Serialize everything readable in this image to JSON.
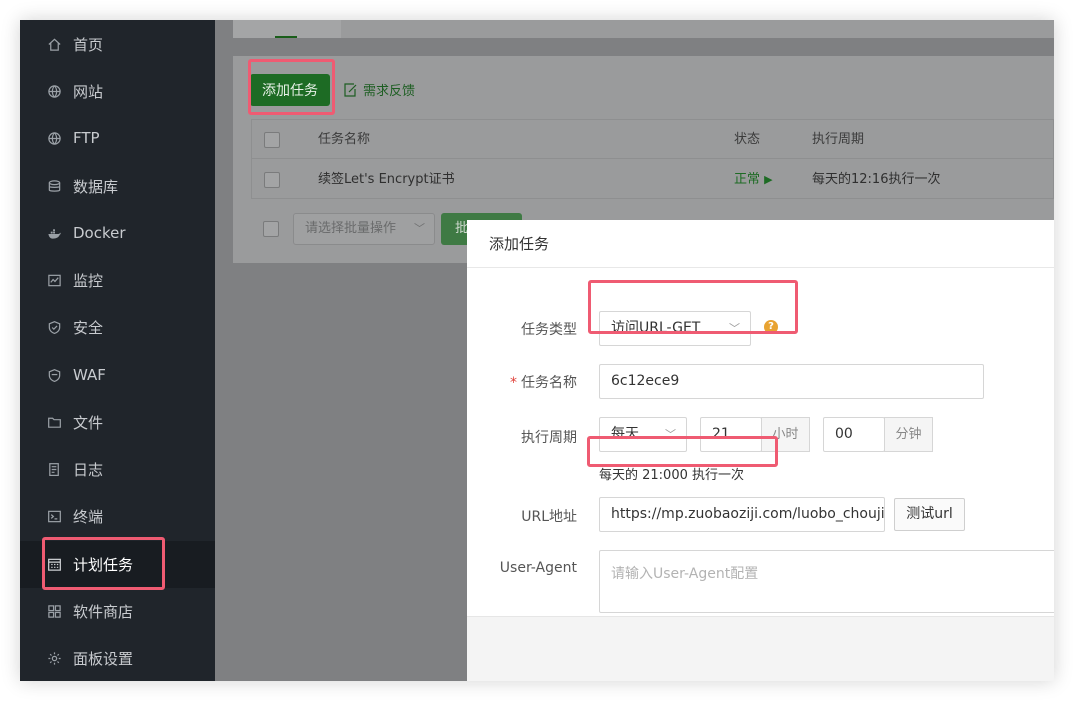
{
  "sidebar": {
    "items": [
      {
        "label": "首页",
        "icon": "home-icon"
      },
      {
        "label": "网站",
        "icon": "globe-icon"
      },
      {
        "label": "FTP",
        "icon": "globe-icon"
      },
      {
        "label": "数据库",
        "icon": "database-icon"
      },
      {
        "label": "Docker",
        "icon": "docker-icon"
      },
      {
        "label": "监控",
        "icon": "monitor-icon"
      },
      {
        "label": "安全",
        "icon": "shield-icon"
      },
      {
        "label": "WAF",
        "icon": "waf-shield-icon"
      },
      {
        "label": "文件",
        "icon": "folder-icon"
      },
      {
        "label": "日志",
        "icon": "log-icon"
      },
      {
        "label": "终端",
        "icon": "terminal-icon"
      },
      {
        "label": "计划任务",
        "icon": "calendar-icon",
        "active": true
      },
      {
        "label": "软件商店",
        "icon": "grid-icon"
      },
      {
        "label": "面板设置",
        "icon": "gear-icon"
      }
    ]
  },
  "toolbar": {
    "add_task_label": "添加任务",
    "feedback_label": "需求反馈"
  },
  "table": {
    "columns": [
      "任务名称",
      "状态",
      "执行周期"
    ],
    "rows": [
      {
        "name": "续签Let's Encrypt证书",
        "status": "正常",
        "status_glyph": "▶",
        "cycle": "每天的12:16执行一次"
      }
    ]
  },
  "bulk": {
    "select_placeholder": "请选择批量操作",
    "apply_label": "批"
  },
  "modal": {
    "title": "添加任务",
    "task_type_label": "任务类型",
    "task_type_value": "访问URL-GET",
    "task_name_label": "任务名称",
    "task_name_value": "6c12ece9",
    "cycle_label": "执行周期",
    "cycle_period": "每天",
    "cycle_hour": "21",
    "cycle_hour_unit": "小时",
    "cycle_minute": "00",
    "cycle_minute_unit": "分钟",
    "cycle_hint": "每天的 21:000 执行一次",
    "url_label": "URL地址",
    "url_value": "https://mp.zuobaoziji.com/luobo_choujiang",
    "test_url_label": "测试url",
    "ua_label": "User-Agent",
    "ua_placeholder": "请输入User-Agent配置"
  },
  "colors": {
    "sidebar_bg": "#20252b",
    "brand_green": "#20a53a",
    "highlight": "#ef5b72",
    "help_orange": "#e8a331"
  }
}
